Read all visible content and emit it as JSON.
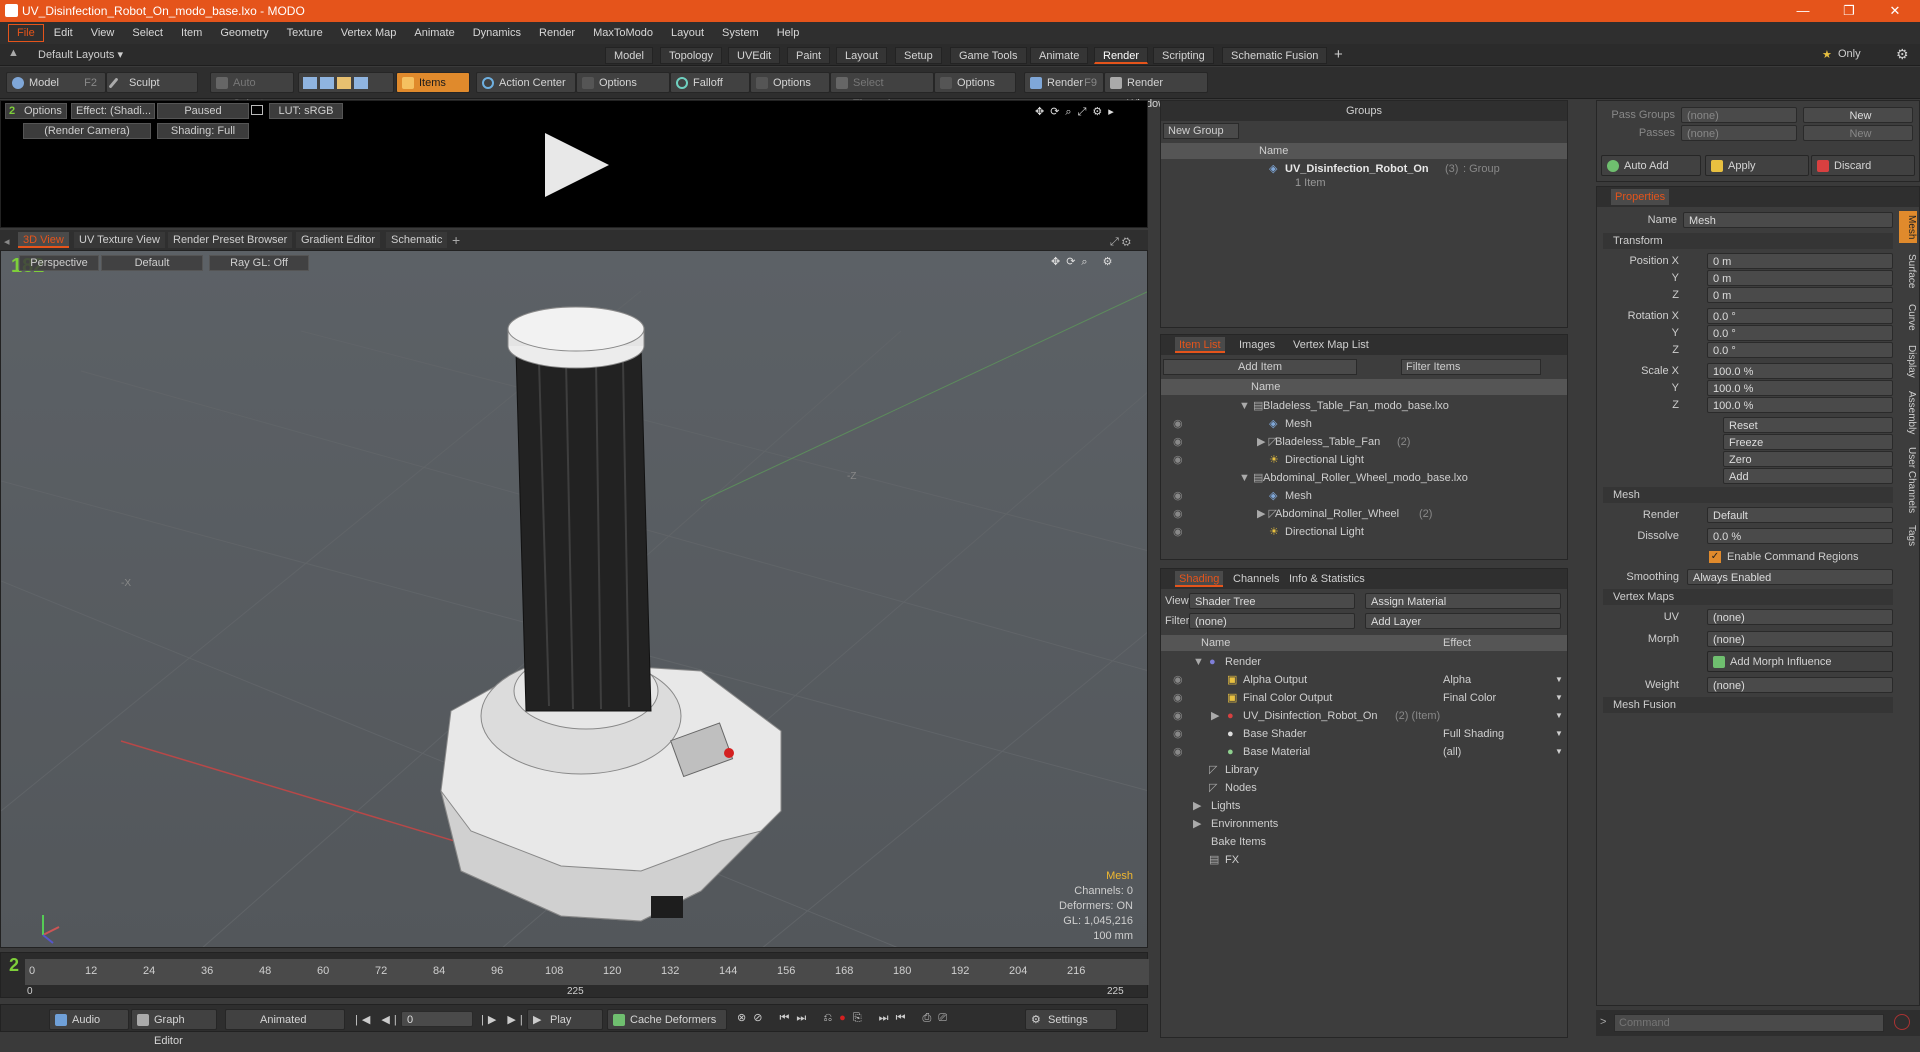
{
  "window": {
    "title": "UV_Disinfection_Robot_On_modo_base.lxo - MODO",
    "min": "—",
    "restore": "❐",
    "close": "✕"
  },
  "menu": [
    "File",
    "Edit",
    "View",
    "Select",
    "Item",
    "Geometry",
    "Texture",
    "Vertex Map",
    "Animate",
    "Dynamics",
    "Render",
    "MaxToModo",
    "Layout",
    "System",
    "Help"
  ],
  "layout": {
    "preset": "Default Layouts ▾",
    "tabs": [
      "Model",
      "Topology",
      "UVEdit",
      "Paint",
      "Layout",
      "Setup",
      "Game Tools",
      "Animate",
      "Render",
      "Scripting",
      "Schematic Fusion"
    ],
    "active": "Render",
    "only": "Only"
  },
  "toolbar": {
    "model": "Model",
    "model_key": "F2",
    "sculpt": "Sculpt",
    "auto_select": "Auto Select",
    "items": "Items",
    "action_center": "Action Center",
    "options1": "Options",
    "falloff": "Falloff",
    "options2": "Options",
    "select_through": "Select Through",
    "options3": "Options",
    "render": "Render",
    "render_key": "F9",
    "render_window": "Render Window"
  },
  "render_preview": {
    "options": "Options",
    "effect": "Effect: (Shadi...",
    "paused": "Paused",
    "lut": "LUT: sRGB",
    "camera": "(Render Camera)",
    "shading": "Shading: Full"
  },
  "viewport_tabs": [
    "3D View",
    "UV Texture View",
    "Render Preset Browser",
    "Gradient Editor",
    "Schematic"
  ],
  "viewport": {
    "perspective": "Perspective",
    "default": "Default",
    "raygl": "Ray GL: Off",
    "stats": [
      "Mesh",
      "Channels: 0",
      "Deformers: ON",
      "GL: 1,045,216",
      "100 mm"
    ]
  },
  "timeline": {
    "ticks": [
      "0",
      "12",
      "24",
      "36",
      "48",
      "60",
      "72",
      "84",
      "96",
      "108",
      "120",
      "132",
      "144",
      "156",
      "168",
      "180",
      "192",
      "204",
      "216"
    ],
    "end1": "225",
    "end2": "225",
    "start": "0"
  },
  "transport": {
    "audio": "Audio",
    "graph_editor": "Graph Editor",
    "animated": "Animated",
    "frame": "0",
    "play": "Play",
    "cache": "Cache Deformers",
    "settings": "Settings"
  },
  "groups": {
    "title": "Groups",
    "new_group": "New Group",
    "col_name": "Name",
    "item_name": "UV_Disinfection_Robot_On",
    "item_count": "(3)",
    "item_type": ": Group",
    "item_sub": "1 Item"
  },
  "itemlist": {
    "tabs": [
      "Item List",
      "Images",
      "Vertex Map List"
    ],
    "add_item": "Add Item",
    "filter": "Filter Items",
    "col_name": "Name",
    "rows": [
      {
        "text": "Bladeless_Table_Fan_modo_base.lxo",
        "indent": 0,
        "dim": false
      },
      {
        "text": "Mesh",
        "indent": 2,
        "dim": true
      },
      {
        "text": "Bladeless_Table_Fan",
        "indent": 1,
        "dim": false,
        "count": "(2)"
      },
      {
        "text": "Directional Light",
        "indent": 1,
        "dim": false
      },
      {
        "text": "Abdominal_Roller_Wheel_modo_base.lxo",
        "indent": 0,
        "dim": false
      },
      {
        "text": "Mesh",
        "indent": 2,
        "dim": true
      },
      {
        "text": "Abdominal_Roller_Wheel",
        "indent": 1,
        "dim": false,
        "count": "(2)"
      },
      {
        "text": "Directional Light",
        "indent": 1,
        "dim": false
      }
    ]
  },
  "shading": {
    "tabs": [
      "Shading",
      "Channels",
      "Info & Statistics"
    ],
    "view_label": "View",
    "view": "Shader Tree",
    "assign": "Assign Material",
    "filter_label": "Filter",
    "filter": "(none)",
    "add_layer": "Add Layer",
    "col_name": "Name",
    "col_effect": "Effect",
    "rows": [
      {
        "name": "Render",
        "effect": "",
        "indent": 1
      },
      {
        "name": "Alpha Output",
        "effect": "Alpha",
        "indent": 2
      },
      {
        "name": "Final Color Output",
        "effect": "Final Color",
        "indent": 2
      },
      {
        "name": "UV_Disinfection_Robot_On",
        "effect": "",
        "indent": 2,
        "extra": "(2) (Item)"
      },
      {
        "name": "Base Shader",
        "effect": "Full Shading",
        "indent": 2
      },
      {
        "name": "Base Material",
        "effect": "(all)",
        "indent": 2
      },
      {
        "name": "Library",
        "effect": "",
        "indent": 1
      },
      {
        "name": "Nodes",
        "effect": "",
        "indent": 1
      },
      {
        "name": "Lights",
        "effect": "",
        "indent": 0
      },
      {
        "name": "Environments",
        "effect": "",
        "indent": 0
      },
      {
        "name": "Bake Items",
        "effect": "",
        "indent": 0
      },
      {
        "name": "FX",
        "effect": "",
        "indent": 0
      }
    ]
  },
  "passes": {
    "pass_groups": "Pass Groups",
    "passes": "Passes",
    "none1": "(none)",
    "none2": "(none)",
    "new1": "New",
    "new2": "New",
    "auto_add": "Auto Add",
    "apply": "Apply",
    "discard": "Discard"
  },
  "properties": {
    "tab": "Properties",
    "name_label": "Name",
    "name": "Mesh",
    "transform": "Transform",
    "pos": [
      "0 m",
      "0 m",
      "0 m"
    ],
    "rot": [
      "0.0 °",
      "0.0 °",
      "0.0 °"
    ],
    "scale": [
      "100.0 %",
      "100.0 %",
      "100.0 %"
    ],
    "labels": {
      "px": "Position X",
      "y": "Y",
      "z": "Z",
      "rx": "Rotation X",
      "sx": "Scale X"
    },
    "buttons": [
      "Reset",
      "Freeze",
      "Zero",
      "Add"
    ],
    "mesh": "Mesh",
    "render_label": "Render",
    "render": "Default",
    "dissolve_label": "Dissolve",
    "dissolve": "0.0 %",
    "enable_cmd": "Enable Command Regions",
    "smoothing_label": "Smoothing",
    "smoothing": "Always Enabled",
    "vertex_maps": "Vertex Maps",
    "uv_label": "UV",
    "uv": "(none)",
    "morph_label": "Morph",
    "morph": "(none)",
    "add_morph": "Add Morph Influence",
    "weight_label": "Weight",
    "weight": "(none)",
    "mesh_fusion": "Mesh Fusion",
    "side_tabs": [
      "Mesh",
      "Surface",
      "Curve",
      "Display",
      "Assembly",
      "User Channels",
      "Tags"
    ]
  },
  "command": {
    "placeholder": "Command"
  }
}
